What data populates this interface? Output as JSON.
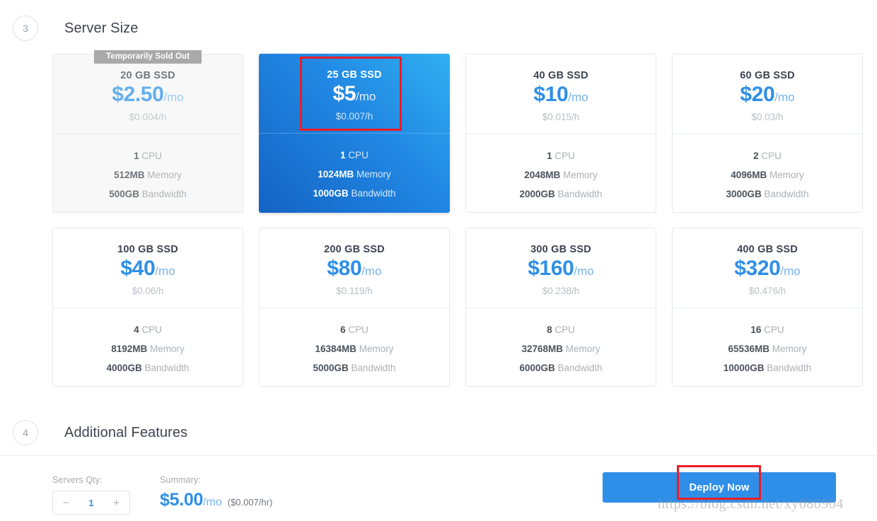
{
  "sections": {
    "server_size": {
      "step": "3",
      "title": "Server Size"
    },
    "additional_features": {
      "step": "4",
      "title": "Additional Features"
    }
  },
  "badges": {
    "sold_out": "Temporarily Sold Out"
  },
  "plans": [
    {
      "title": "20 GB SSD",
      "price": "$2.50",
      "per": "/mo",
      "hourly": "$0.004/h",
      "cpu_value": "1",
      "cpu_label": "CPU",
      "memory_value": "512MB",
      "memory_label": "Memory",
      "bandwidth_value": "500GB",
      "bandwidth_label": "Bandwidth",
      "state": "sold-out"
    },
    {
      "title": "25 GB SSD",
      "price": "$5",
      "per": "/mo",
      "hourly": "$0.007/h",
      "cpu_value": "1",
      "cpu_label": "CPU",
      "memory_value": "1024MB",
      "memory_label": "Memory",
      "bandwidth_value": "1000GB",
      "bandwidth_label": "Bandwidth",
      "state": "selected"
    },
    {
      "title": "40 GB SSD",
      "price": "$10",
      "per": "/mo",
      "hourly": "$0.015/h",
      "cpu_value": "1",
      "cpu_label": "CPU",
      "memory_value": "2048MB",
      "memory_label": "Memory",
      "bandwidth_value": "2000GB",
      "bandwidth_label": "Bandwidth",
      "state": "available"
    },
    {
      "title": "60 GB SSD",
      "price": "$20",
      "per": "/mo",
      "hourly": "$0.03/h",
      "cpu_value": "2",
      "cpu_label": "CPU",
      "memory_value": "4096MB",
      "memory_label": "Memory",
      "bandwidth_value": "3000GB",
      "bandwidth_label": "Bandwidth",
      "state": "available"
    },
    {
      "title": "100 GB SSD",
      "price": "$40",
      "per": "/mo",
      "hourly": "$0.06/h",
      "cpu_value": "4",
      "cpu_label": "CPU",
      "memory_value": "8192MB",
      "memory_label": "Memory",
      "bandwidth_value": "4000GB",
      "bandwidth_label": "Bandwidth",
      "state": "available"
    },
    {
      "title": "200 GB SSD",
      "price": "$80",
      "per": "/mo",
      "hourly": "$0.119/h",
      "cpu_value": "6",
      "cpu_label": "CPU",
      "memory_value": "16384MB",
      "memory_label": "Memory",
      "bandwidth_value": "5000GB",
      "bandwidth_label": "Bandwidth",
      "state": "available"
    },
    {
      "title": "300 GB SSD",
      "price": "$160",
      "per": "/mo",
      "hourly": "$0.238/h",
      "cpu_value": "8",
      "cpu_label": "CPU",
      "memory_value": "32768MB",
      "memory_label": "Memory",
      "bandwidth_value": "6000GB",
      "bandwidth_label": "Bandwidth",
      "state": "available"
    },
    {
      "title": "400 GB SSD",
      "price": "$320",
      "per": "/mo",
      "hourly": "$0.476/h",
      "cpu_value": "16",
      "cpu_label": "CPU",
      "memory_value": "65536MB",
      "memory_label": "Memory",
      "bandwidth_value": "10000GB",
      "bandwidth_label": "Bandwidth",
      "state": "available"
    }
  ],
  "footer": {
    "qty_label": "Servers Qty:",
    "qty_value": "1",
    "qty_decrement": "−",
    "qty_increment": "+",
    "summary_label": "Summary:",
    "summary_price": "$5.00",
    "summary_per": "/mo",
    "summary_hourly": "($0.007/hr)",
    "deploy_label": "Deploy Now"
  },
  "watermark": "https://blog.csdn.net/xy080904",
  "colors": {
    "accent_blue": "#2f8fe8",
    "annotation_red": "#ee1c25",
    "sold_out_gray": "#a9a9a9",
    "selected_gradient_light": "#31b0f2",
    "selected_gradient_dark": "#1463c4"
  }
}
